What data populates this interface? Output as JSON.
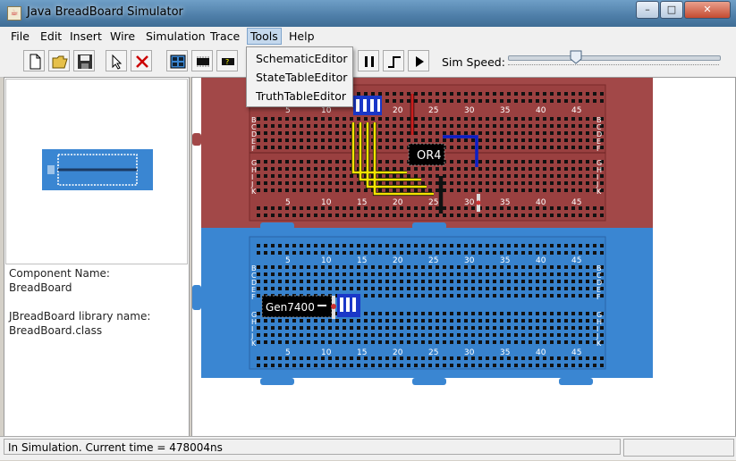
{
  "window": {
    "title": "Java BreadBoard Simulator",
    "min": "–",
    "max": "□",
    "close": "✕"
  },
  "menubar": {
    "items": [
      {
        "label": "File"
      },
      {
        "label": "Edit"
      },
      {
        "label": "Insert"
      },
      {
        "label": "Wire"
      },
      {
        "label": "Simulation"
      },
      {
        "label": "Trace"
      },
      {
        "label": "Tools"
      },
      {
        "label": "Help"
      }
    ]
  },
  "tools_menu": {
    "items": [
      {
        "label": "SchematicEditor"
      },
      {
        "label": "StateTableEditor"
      },
      {
        "label": "TruthTableEditor"
      }
    ]
  },
  "toolbar": {
    "icons": [
      "new-file-icon",
      "open-folder-icon",
      "save-icon",
      "select-arrow-icon",
      "delete-icon",
      "breadboard-icon",
      "chip-icon",
      "chip-help-icon",
      "pause-icon",
      "step-icon",
      "play-icon"
    ],
    "sim_speed_label": "Sim Speed:",
    "sim_speed_fraction": 0.32
  },
  "side_panel": {
    "component_name_label": "Component Name:",
    "component_name_value": "BreadBoard",
    "library_label": "JBreadBoard library name:",
    "library_value": "BreadBoard.class"
  },
  "breadboard": {
    "column_numbers": [
      "5",
      "10",
      "15",
      "20",
      "25",
      "30",
      "35",
      "40",
      "45"
    ],
    "row_letters_top": [
      "B",
      "C",
      "D",
      "E",
      "F"
    ],
    "row_letters_bottom": [
      "G",
      "H",
      "I",
      "J",
      "K"
    ],
    "chips": [
      {
        "label": "OR4"
      },
      {
        "label": "Gen7400"
      }
    ],
    "colors": {
      "upper": "#a24848",
      "lower": "#3a86d2",
      "wire_yellow": "#f5e400",
      "wire_red": "#cc1c1c",
      "wire_blue": "#0a1fc8"
    }
  },
  "status": {
    "text": "In Simulation.  Current time = 478004ns"
  }
}
